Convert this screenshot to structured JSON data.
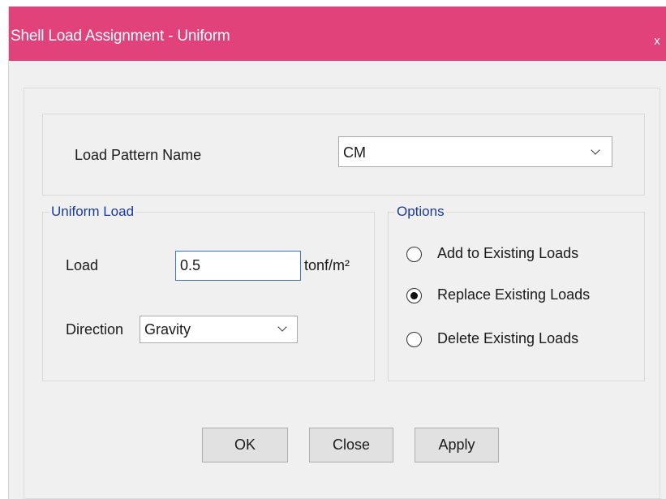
{
  "window": {
    "title": "Shell Load Assignment - Uniform",
    "close_label": "x",
    "accent_color": "#e1427a"
  },
  "load_pattern": {
    "label": "Load Pattern Name",
    "selected": "CM"
  },
  "uniform_load": {
    "group_title": "Uniform Load",
    "load_label": "Load",
    "load_value": "0.5",
    "load_unit": "tonf/m²",
    "direction_label": "Direction",
    "direction_selected": "Gravity"
  },
  "options": {
    "group_title": "Options",
    "items": [
      {
        "label": "Add to Existing Loads",
        "checked": false
      },
      {
        "label": "Replace Existing Loads",
        "checked": true
      },
      {
        "label": "Delete Existing Loads",
        "checked": false
      }
    ]
  },
  "buttons": {
    "ok": "OK",
    "close": "Close",
    "apply": "Apply"
  }
}
